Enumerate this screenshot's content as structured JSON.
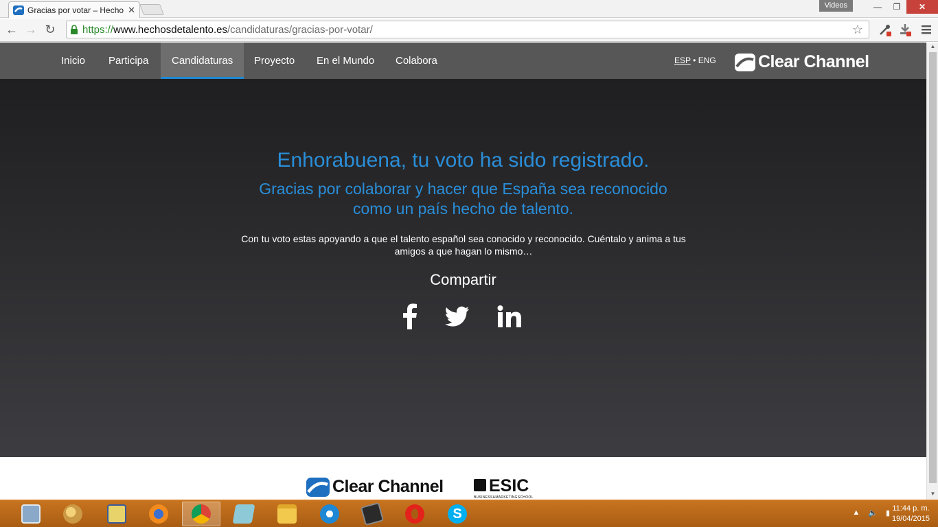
{
  "browser": {
    "tab_title": "Gracias por votar – Hecho",
    "window_label": "Videos",
    "url_scheme": "https://",
    "url_host": "www.hechosdetalento.es",
    "url_path": "/candidaturas/gracias-por-votar/"
  },
  "nav": {
    "items": [
      {
        "label": "Inicio"
      },
      {
        "label": "Participa"
      },
      {
        "label": "Candidaturas",
        "active": true
      },
      {
        "label": "Proyecto"
      },
      {
        "label": "En el Mundo"
      },
      {
        "label": "Colabora"
      }
    ],
    "lang_esp": "ESP",
    "lang_sep": "•",
    "lang_eng": "ENG",
    "brand": "Clear Channel"
  },
  "hero": {
    "title": "Enhorabuena, tu voto ha sido registrado.",
    "subtitle": "Gracias por colaborar y hacer que España sea reconocido como un país hecho de talento.",
    "body": "Con tu voto estas apoyando a que el talento español sea conocido y reconocido. Cuéntalo y anima a tus amigos a que hagan lo mismo…",
    "share_label": "Compartir",
    "social": [
      "facebook-icon",
      "twitter-icon",
      "linkedin-icon"
    ]
  },
  "footer": {
    "brand": "Clear Channel",
    "partner": "ESIC",
    "partner_tagline": "BUSINESS&MARKETINGSCHOOL"
  },
  "taskbar": {
    "apps": [
      "calculator-icon",
      "paint-icon",
      "notepad-icon",
      "firefox-icon",
      "chrome-icon",
      "onenote-icon",
      "file-explorer-icon",
      "internet-explorer-icon",
      "terminal-icon",
      "opera-icon",
      "skype-icon"
    ],
    "active_app": "chrome-icon",
    "time": "11:44 p. m.",
    "date": "19/04/2015"
  },
  "colors": {
    "accent_blue": "#2a8ed8",
    "nav_bg": "#575757",
    "taskbar": "#b86616"
  }
}
